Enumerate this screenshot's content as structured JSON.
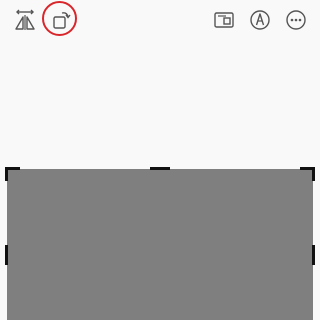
{
  "toolbar": {
    "flip": {
      "icon": "flip-horizontal-icon",
      "tooltip": ""
    },
    "rotate": {
      "icon": "rotate-icon",
      "highlighted": true,
      "highlight_color": "#d9262b"
    },
    "aspect": {
      "icon": "aspect-ratio-icon"
    },
    "markup": {
      "icon": "markup-pen-icon"
    },
    "more": {
      "icon": "more-icon"
    }
  },
  "colors": {
    "background": "#f9f9f9",
    "icon": "#555555",
    "image_fill": "#7f7f7f",
    "crop_handles": "#111111",
    "highlight": "#d9262b"
  }
}
